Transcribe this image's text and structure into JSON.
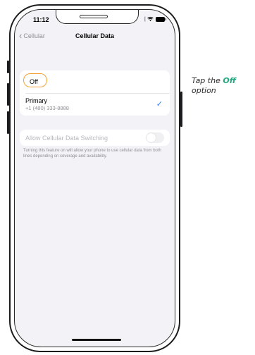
{
  "status_bar": {
    "time": "11:12"
  },
  "navigation": {
    "back_label": "Cellular",
    "title": "Cellular Data"
  },
  "options": {
    "off_label": "Off",
    "primary_title": "Primary",
    "primary_number": "+1 (480) 333-8888"
  },
  "data_switching": {
    "label": "Allow Cellular Data Switching",
    "enabled": false,
    "footnote": "Turning this feature on will allow your phone to use cellular data from both lines depending on coverage and availability."
  },
  "instruction": {
    "prefix": "Tap the ",
    "highlight": "Off",
    "suffix": " option"
  },
  "colors": {
    "highlight_ring": "#f4a236",
    "accent_blue": "#2f7ef6",
    "instruction_green": "#21a87e"
  },
  "icons": [
    "chevron-left-icon",
    "checkmark-icon",
    "wifi-icon",
    "battery-icon",
    "signal-icon"
  ]
}
